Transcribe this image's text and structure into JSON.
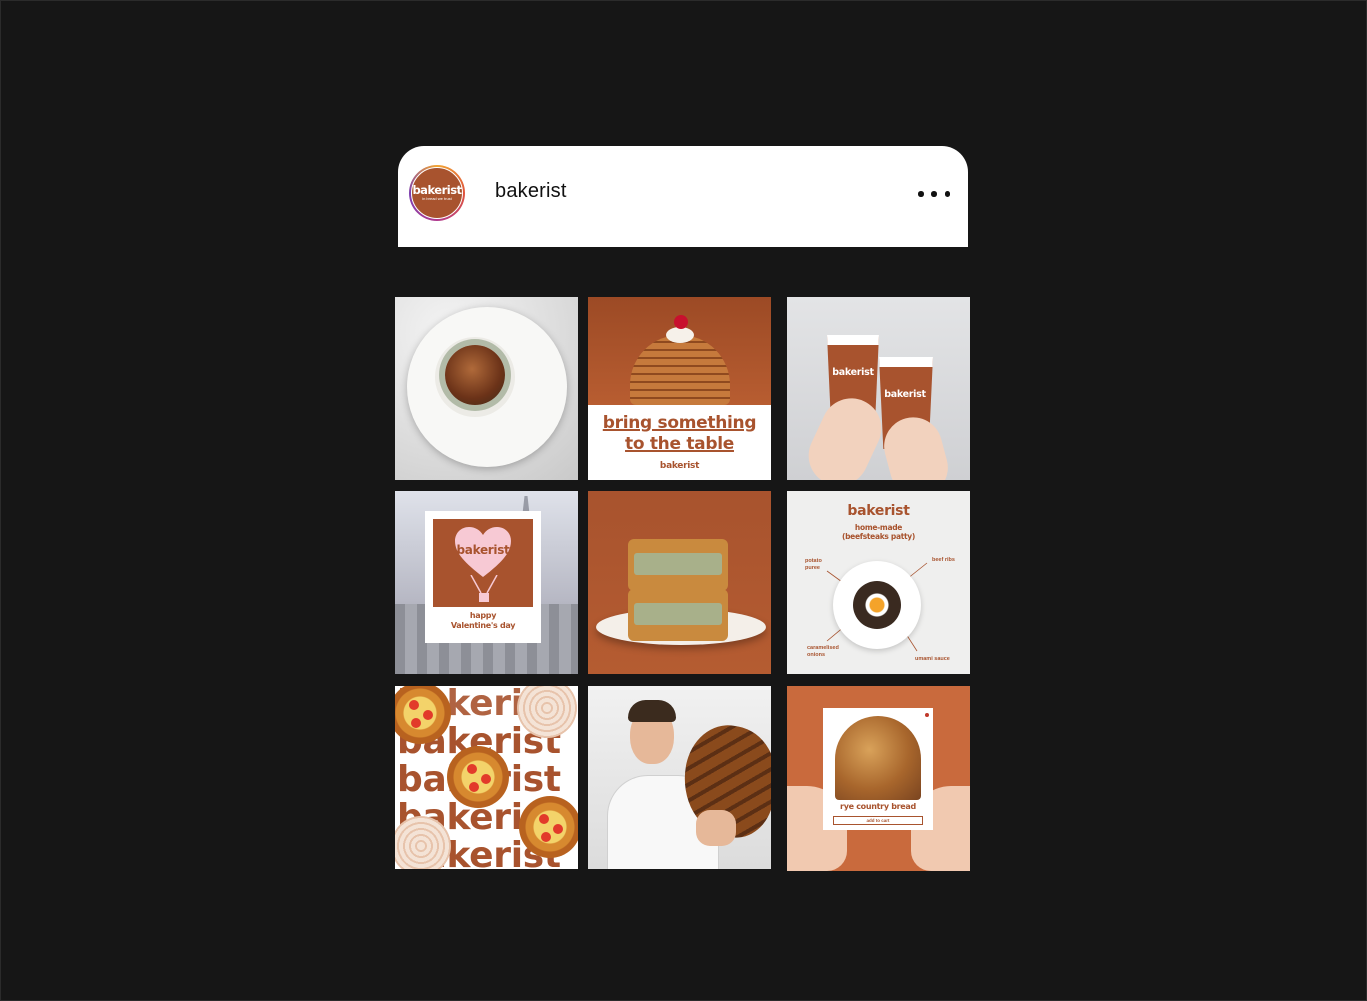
{
  "profile": {
    "username": "bakerist",
    "avatar": {
      "brand": "bakerist",
      "tagline": "in bread we trust"
    }
  },
  "grid": {
    "post2": {
      "headline_line1": "bring something",
      "headline_line2": "to the table",
      "signature": "bakerist"
    },
    "post3": {
      "cup_brand": "bakerist"
    },
    "post4": {
      "brand": "bakerist",
      "caption_line1": "happy",
      "caption_line2": "Valentine's day"
    },
    "post6": {
      "brand": "bakerist",
      "subtitle_line1": "home-made",
      "subtitle_line2": "(beefsteaks patty)",
      "labels": {
        "potato": "potato puree",
        "beef_ribs": "beef ribs",
        "onions": "caramelised onions",
        "sauce": "umami sauce"
      }
    },
    "post7": {
      "pattern_word": "bakerist"
    },
    "post9": {
      "product": "rye country bread",
      "cart": "add to cart"
    }
  },
  "colors": {
    "brand": "#a8532e",
    "background": "#161616"
  }
}
